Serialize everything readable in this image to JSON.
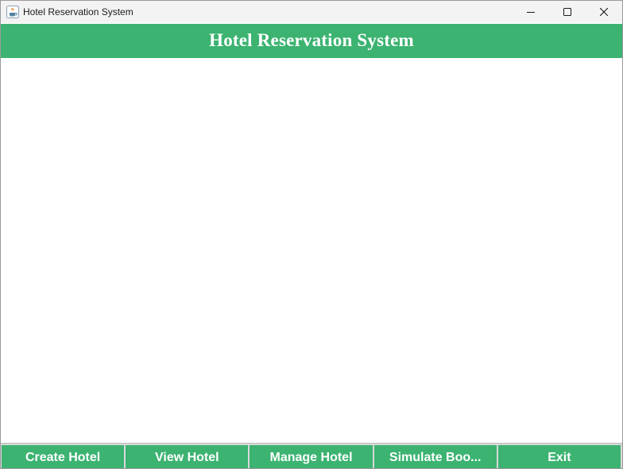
{
  "window": {
    "title": "Hotel Reservation System",
    "icon": "java-cup-icon"
  },
  "header": {
    "title": "Hotel Reservation System",
    "background_color": "#3cb371",
    "text_color": "#ffffff"
  },
  "controls": {
    "minimize_icon": "minimize-icon",
    "maximize_icon": "maximize-icon",
    "close_icon": "close-icon"
  },
  "buttons": [
    {
      "label": "Create Hotel"
    },
    {
      "label": "View Hotel"
    },
    {
      "label": "Manage Hotel"
    },
    {
      "label": "Simulate Boo..."
    },
    {
      "label": "Exit"
    }
  ]
}
